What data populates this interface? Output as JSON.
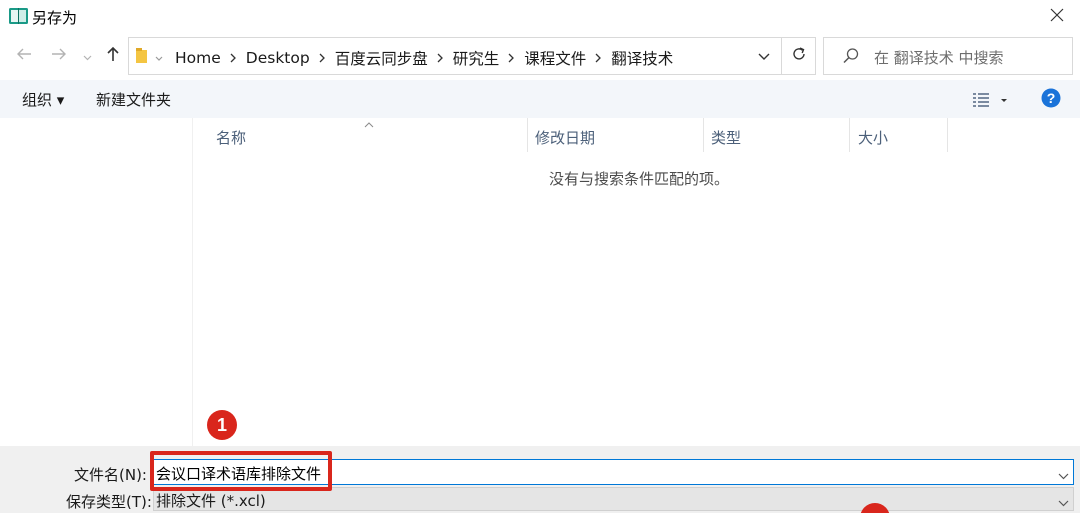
{
  "window": {
    "title": "另存为",
    "icon": "save-dialog-book-icon"
  },
  "nav": {
    "breadcrumbs": [
      "Home",
      "Desktop",
      "百度云同步盘",
      "研究生",
      "课程文件",
      "翻译技术"
    ],
    "search_placeholder": "在 翻译技术 中搜索"
  },
  "toolbar": {
    "organize_label": "组织 ▾",
    "new_folder_label": "新建文件夹"
  },
  "file_list": {
    "columns": [
      "名称",
      "修改日期",
      "类型",
      "大小"
    ],
    "empty_message": "没有与搜索条件匹配的项。"
  },
  "form": {
    "filename_label": "文件名(N):",
    "filename_value": "会议口译术语库排除文件",
    "filetype_label": "保存类型(T):",
    "filetype_value": "排除文件 (*.xcl)"
  },
  "annotations": {
    "marker_1": "1",
    "accent_color": "#d9261c"
  },
  "colors": {
    "toolbar_bg": "#f3f6fa",
    "help_blue": "#1a73d9",
    "column_header_text": "#4c607a"
  }
}
